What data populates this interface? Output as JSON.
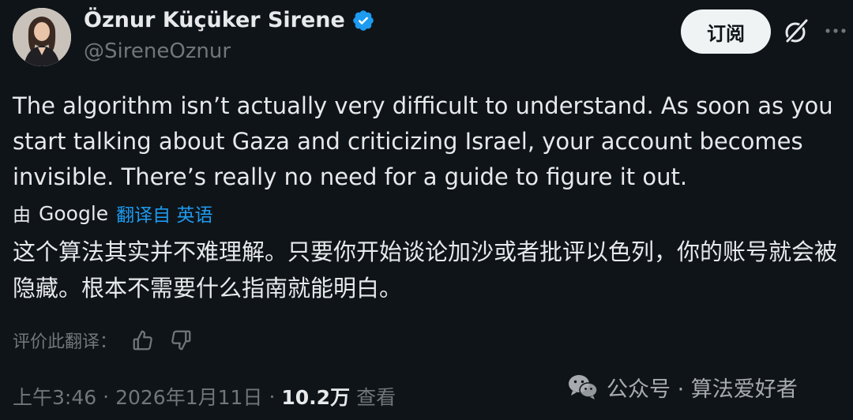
{
  "header": {
    "display_name": "Öznur Küçüker Sirene",
    "handle": "@SireneOznur",
    "subscribe_label": "订阅"
  },
  "tweet": {
    "text": "The algorithm isn’t actually very difficult to understand. As soon as you start talking about Gaza and criticizing Israel, your account becomes invisible. There’s really no need for a guide to figure it out.",
    "translation": {
      "by_label": "由",
      "provider": "Google",
      "link_text": "翻译自 英语",
      "translated_text": "这个算法其实并不难理解。只要你开始谈论加沙或者批评以色列，你的账号就会被隐藏。根本不需要什么指南就能明白。",
      "rate_label": "评价此翻译："
    },
    "meta": {
      "time": "上午3:46",
      "separator": "·",
      "date": "2026年1月11日",
      "views_count": "10.2万",
      "views_label": "查看"
    }
  },
  "watermark": {
    "text": "公众号 · 算法爱好者"
  },
  "colors": {
    "background": "#0f1419",
    "text_primary": "#e7e9ea",
    "text_secondary": "#71767b",
    "accent": "#1d9bf0",
    "verified": "#1d9bf0"
  },
  "icons": [
    "verified-badge-icon",
    "grok-icon",
    "more-icon",
    "thumbs-up-icon",
    "thumbs-down-icon",
    "wechat-icon"
  ]
}
